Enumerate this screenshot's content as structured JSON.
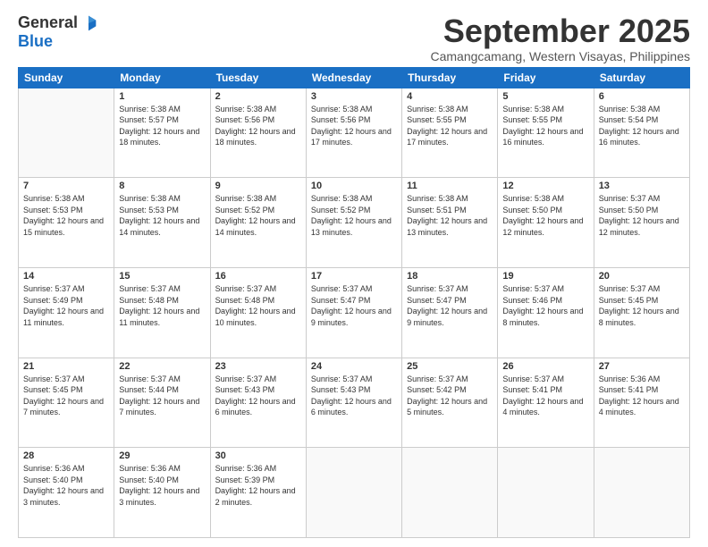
{
  "logo": {
    "general": "General",
    "blue": "Blue"
  },
  "title": "September 2025",
  "location": "Camangcamang, Western Visayas, Philippines",
  "days": [
    "Sunday",
    "Monday",
    "Tuesday",
    "Wednesday",
    "Thursday",
    "Friday",
    "Saturday"
  ],
  "weeks": [
    [
      {
        "day": "",
        "sunrise": "",
        "sunset": "",
        "daylight": ""
      },
      {
        "day": "1",
        "sunrise": "Sunrise: 5:38 AM",
        "sunset": "Sunset: 5:57 PM",
        "daylight": "Daylight: 12 hours and 18 minutes."
      },
      {
        "day": "2",
        "sunrise": "Sunrise: 5:38 AM",
        "sunset": "Sunset: 5:56 PM",
        "daylight": "Daylight: 12 hours and 18 minutes."
      },
      {
        "day": "3",
        "sunrise": "Sunrise: 5:38 AM",
        "sunset": "Sunset: 5:56 PM",
        "daylight": "Daylight: 12 hours and 17 minutes."
      },
      {
        "day": "4",
        "sunrise": "Sunrise: 5:38 AM",
        "sunset": "Sunset: 5:55 PM",
        "daylight": "Daylight: 12 hours and 17 minutes."
      },
      {
        "day": "5",
        "sunrise": "Sunrise: 5:38 AM",
        "sunset": "Sunset: 5:55 PM",
        "daylight": "Daylight: 12 hours and 16 minutes."
      },
      {
        "day": "6",
        "sunrise": "Sunrise: 5:38 AM",
        "sunset": "Sunset: 5:54 PM",
        "daylight": "Daylight: 12 hours and 16 minutes."
      }
    ],
    [
      {
        "day": "7",
        "sunrise": "Sunrise: 5:38 AM",
        "sunset": "Sunset: 5:53 PM",
        "daylight": "Daylight: 12 hours and 15 minutes."
      },
      {
        "day": "8",
        "sunrise": "Sunrise: 5:38 AM",
        "sunset": "Sunset: 5:53 PM",
        "daylight": "Daylight: 12 hours and 14 minutes."
      },
      {
        "day": "9",
        "sunrise": "Sunrise: 5:38 AM",
        "sunset": "Sunset: 5:52 PM",
        "daylight": "Daylight: 12 hours and 14 minutes."
      },
      {
        "day": "10",
        "sunrise": "Sunrise: 5:38 AM",
        "sunset": "Sunset: 5:52 PM",
        "daylight": "Daylight: 12 hours and 13 minutes."
      },
      {
        "day": "11",
        "sunrise": "Sunrise: 5:38 AM",
        "sunset": "Sunset: 5:51 PM",
        "daylight": "Daylight: 12 hours and 13 minutes."
      },
      {
        "day": "12",
        "sunrise": "Sunrise: 5:38 AM",
        "sunset": "Sunset: 5:50 PM",
        "daylight": "Daylight: 12 hours and 12 minutes."
      },
      {
        "day": "13",
        "sunrise": "Sunrise: 5:37 AM",
        "sunset": "Sunset: 5:50 PM",
        "daylight": "Daylight: 12 hours and 12 minutes."
      }
    ],
    [
      {
        "day": "14",
        "sunrise": "Sunrise: 5:37 AM",
        "sunset": "Sunset: 5:49 PM",
        "daylight": "Daylight: 12 hours and 11 minutes."
      },
      {
        "day": "15",
        "sunrise": "Sunrise: 5:37 AM",
        "sunset": "Sunset: 5:48 PM",
        "daylight": "Daylight: 12 hours and 11 minutes."
      },
      {
        "day": "16",
        "sunrise": "Sunrise: 5:37 AM",
        "sunset": "Sunset: 5:48 PM",
        "daylight": "Daylight: 12 hours and 10 minutes."
      },
      {
        "day": "17",
        "sunrise": "Sunrise: 5:37 AM",
        "sunset": "Sunset: 5:47 PM",
        "daylight": "Daylight: 12 hours and 9 minutes."
      },
      {
        "day": "18",
        "sunrise": "Sunrise: 5:37 AM",
        "sunset": "Sunset: 5:47 PM",
        "daylight": "Daylight: 12 hours and 9 minutes."
      },
      {
        "day": "19",
        "sunrise": "Sunrise: 5:37 AM",
        "sunset": "Sunset: 5:46 PM",
        "daylight": "Daylight: 12 hours and 8 minutes."
      },
      {
        "day": "20",
        "sunrise": "Sunrise: 5:37 AM",
        "sunset": "Sunset: 5:45 PM",
        "daylight": "Daylight: 12 hours and 8 minutes."
      }
    ],
    [
      {
        "day": "21",
        "sunrise": "Sunrise: 5:37 AM",
        "sunset": "Sunset: 5:45 PM",
        "daylight": "Daylight: 12 hours and 7 minutes."
      },
      {
        "day": "22",
        "sunrise": "Sunrise: 5:37 AM",
        "sunset": "Sunset: 5:44 PM",
        "daylight": "Daylight: 12 hours and 7 minutes."
      },
      {
        "day": "23",
        "sunrise": "Sunrise: 5:37 AM",
        "sunset": "Sunset: 5:43 PM",
        "daylight": "Daylight: 12 hours and 6 minutes."
      },
      {
        "day": "24",
        "sunrise": "Sunrise: 5:37 AM",
        "sunset": "Sunset: 5:43 PM",
        "daylight": "Daylight: 12 hours and 6 minutes."
      },
      {
        "day": "25",
        "sunrise": "Sunrise: 5:37 AM",
        "sunset": "Sunset: 5:42 PM",
        "daylight": "Daylight: 12 hours and 5 minutes."
      },
      {
        "day": "26",
        "sunrise": "Sunrise: 5:37 AM",
        "sunset": "Sunset: 5:41 PM",
        "daylight": "Daylight: 12 hours and 4 minutes."
      },
      {
        "day": "27",
        "sunrise": "Sunrise: 5:36 AM",
        "sunset": "Sunset: 5:41 PM",
        "daylight": "Daylight: 12 hours and 4 minutes."
      }
    ],
    [
      {
        "day": "28",
        "sunrise": "Sunrise: 5:36 AM",
        "sunset": "Sunset: 5:40 PM",
        "daylight": "Daylight: 12 hours and 3 minutes."
      },
      {
        "day": "29",
        "sunrise": "Sunrise: 5:36 AM",
        "sunset": "Sunset: 5:40 PM",
        "daylight": "Daylight: 12 hours and 3 minutes."
      },
      {
        "day": "30",
        "sunrise": "Sunrise: 5:36 AM",
        "sunset": "Sunset: 5:39 PM",
        "daylight": "Daylight: 12 hours and 2 minutes."
      },
      {
        "day": "",
        "sunrise": "",
        "sunset": "",
        "daylight": ""
      },
      {
        "day": "",
        "sunrise": "",
        "sunset": "",
        "daylight": ""
      },
      {
        "day": "",
        "sunrise": "",
        "sunset": "",
        "daylight": ""
      },
      {
        "day": "",
        "sunrise": "",
        "sunset": "",
        "daylight": ""
      }
    ]
  ]
}
